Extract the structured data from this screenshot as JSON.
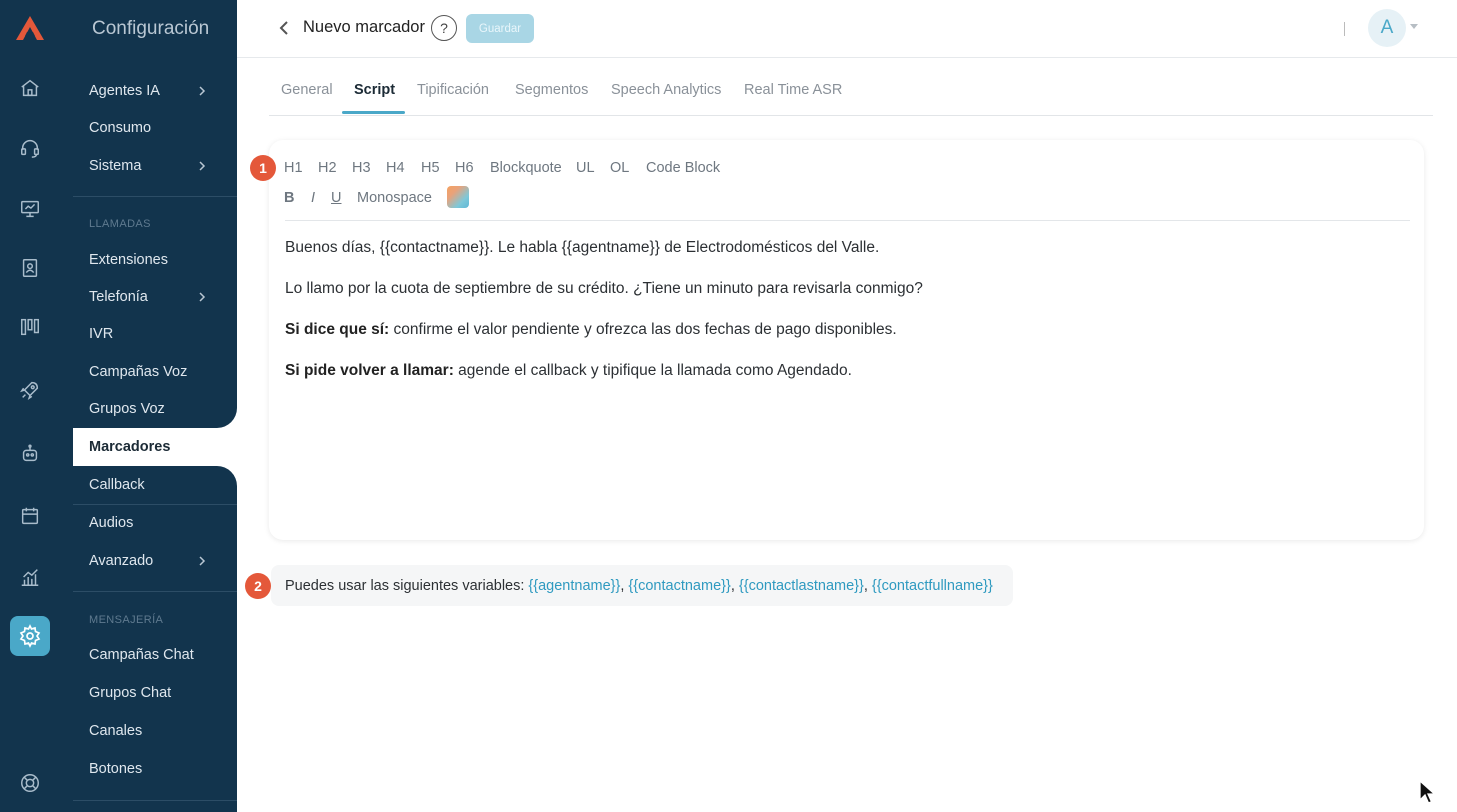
{
  "app": {
    "settings_title": "Configuración"
  },
  "rail": {
    "icons": [
      "logo-icon",
      "home-icon",
      "headset-icon",
      "monitor-icon",
      "contact-book-icon",
      "board-icon",
      "rocket-icon",
      "robot-icon",
      "calendar-icon",
      "analytics-icon",
      "settings-icon",
      "support-icon"
    ],
    "active": "settings-icon"
  },
  "nav": {
    "items_top": [
      {
        "label": "Agentes IA",
        "chevron": true
      },
      {
        "label": "Consumo",
        "chevron": false
      },
      {
        "label": "Sistema",
        "chevron": true
      }
    ],
    "section_calls": "LLAMADAS",
    "items_calls": [
      {
        "label": "Extensiones",
        "chevron": false
      },
      {
        "label": "Telefonía",
        "chevron": true
      },
      {
        "label": "IVR",
        "chevron": false
      },
      {
        "label": "Campañas Voz",
        "chevron": false
      },
      {
        "label": "Grupos Voz",
        "chevron": false
      },
      {
        "label": "Marcadores",
        "chevron": false,
        "selected": true
      },
      {
        "label": "Callback",
        "chevron": false
      },
      {
        "label": "Audios",
        "chevron": false
      },
      {
        "label": "Avanzado",
        "chevron": true
      }
    ],
    "section_messaging": "MENSAJERÍA",
    "items_messaging": [
      {
        "label": "Campañas Chat"
      },
      {
        "label": "Grupos Chat"
      },
      {
        "label": "Canales"
      },
      {
        "label": "Botones"
      }
    ]
  },
  "header": {
    "title": "Nuevo marcador",
    "help": "?",
    "save_label": "Guardar",
    "avatar_letter": "A"
  },
  "tabs": [
    {
      "label": "General"
    },
    {
      "label": "Script",
      "active": true
    },
    {
      "label": "Tipificación"
    },
    {
      "label": "Segmentos"
    },
    {
      "label": "Speech Analytics"
    },
    {
      "label": "Real Time ASR"
    }
  ],
  "editor": {
    "badge": "1",
    "toolbar_row1": [
      "H1",
      "H2",
      "H3",
      "H4",
      "H5",
      "H6",
      "Blockquote",
      "UL",
      "OL",
      "Code Block"
    ],
    "toolbar_row2": [
      "B",
      "I",
      "U",
      "Monospace"
    ],
    "paragraphs": [
      {
        "bold": "",
        "text": "Buenos días, {{contactname}}. Le habla {{agentname}} de Electrodomésticos del Valle."
      },
      {
        "bold": "",
        "text": "Lo llamo por la cuota de septiembre de su crédito. ¿Tiene un minuto para revisarla conmigo?"
      },
      {
        "bold": "Si dice que sí:",
        "text": " confirme el valor pendiente y ofrezca las dos fechas de pago disponibles."
      },
      {
        "bold": "Si pide volver a llamar:",
        "text": " agende el callback y tipifique la llamada como Agendado."
      }
    ]
  },
  "variables": {
    "badge": "2",
    "prefix": "Puedes usar las siguientes variables:",
    "items": [
      "{{agentname}}",
      "{{contactname}}",
      "{{contactlastname}}",
      "{{contactfullname}}"
    ]
  },
  "colors": {
    "sidebar": "#12344d",
    "accent": "#4aa8c8",
    "badge": "#e4583a"
  }
}
